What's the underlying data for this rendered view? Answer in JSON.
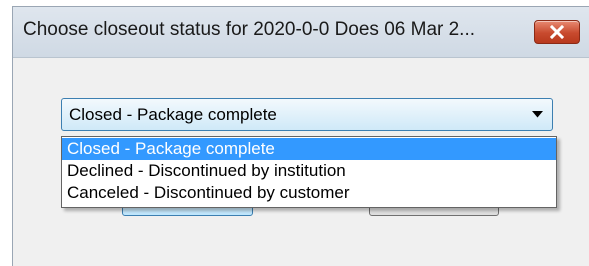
{
  "window": {
    "title": "Choose closeout status for 2020-0-0 Does 06 Mar 2..."
  },
  "status_select": {
    "selected_value": "Closed - Package complete",
    "options": [
      {
        "label": "Closed - Package complete",
        "highlighted": true
      },
      {
        "label": "Declined - Discontinued by institution",
        "highlighted": false
      },
      {
        "label": "Canceled - Discontinued by customer",
        "highlighted": false
      }
    ]
  },
  "colors": {
    "highlight": "#3399ff",
    "close_button": "#c84a2e"
  }
}
